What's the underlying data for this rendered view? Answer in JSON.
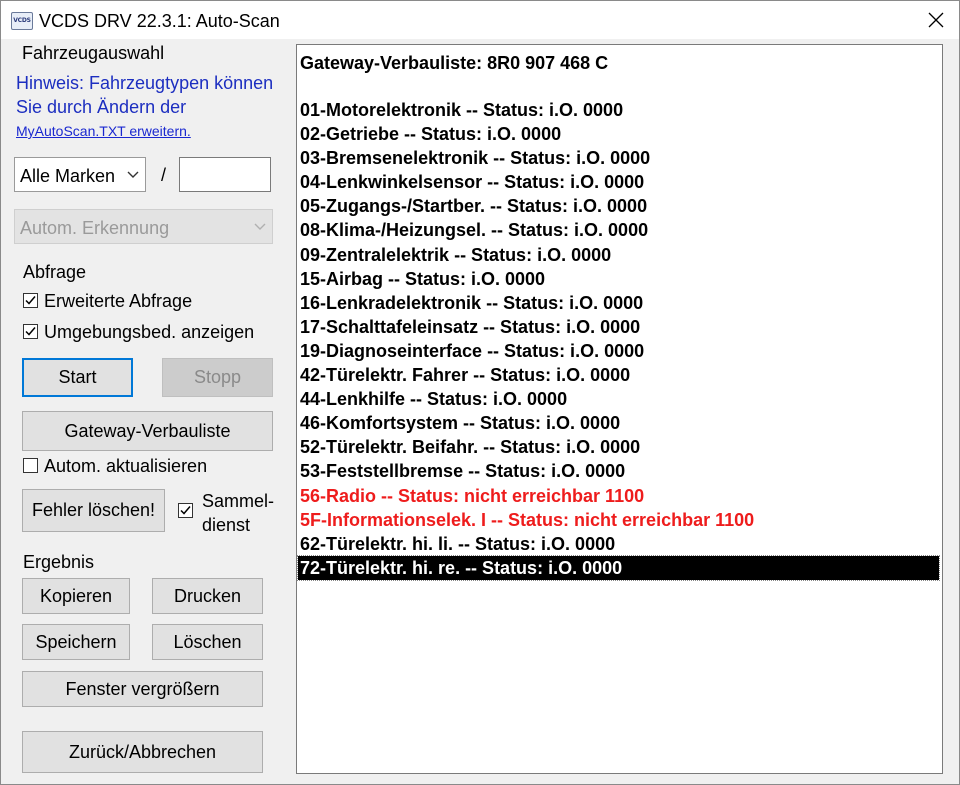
{
  "window": {
    "app_icon_text": "VCDS",
    "title": "VCDS DRV 22.3.1:  Auto-Scan"
  },
  "left_panel": {
    "vehicle_selection_label": "Fahrzeugauswahl",
    "hint_text": "Hinweis: Fahrzeugtypen können Sie durch Ändern der",
    "hint_link": "MyAutoScan.TXT erweitern.",
    "make_dropdown_value": "Alle Marken",
    "slash": "/",
    "model_input_value": "",
    "detection_dropdown_value": "Autom. Erkennung",
    "query_label": "Abfrage",
    "extended_query": {
      "label": "Erweiterte Abfrage",
      "checked": true
    },
    "show_environment": {
      "label": "Umgebungsbed. anzeigen",
      "checked": true
    },
    "start_button": "Start",
    "stop_button": "Stopp",
    "gateway_button": "Gateway-Verbauliste",
    "auto_update": {
      "label": "Autom. aktualisieren",
      "checked": false
    },
    "clear_faults_button": "Fehler löschen!",
    "collective_service": {
      "label_line1": "Sammel-",
      "label_line2": "dienst",
      "checked": true
    },
    "result_label": "Ergebnis",
    "copy_button": "Kopieren",
    "print_button": "Drucken",
    "save_button": "Speichern",
    "delete_button": "Löschen",
    "enlarge_button": "Fenster vergrößern",
    "back_button": "Zurück/Abbrechen"
  },
  "results": {
    "header": "Gateway-Verbauliste:  8R0 907 468 C",
    "items": [
      {
        "text": "01-Motorelektronik -- Status: i.O. 0000",
        "state": "ok"
      },
      {
        "text": "02-Getriebe -- Status: i.O. 0000",
        "state": "ok"
      },
      {
        "text": "03-Bremsenelektronik -- Status: i.O. 0000",
        "state": "ok"
      },
      {
        "text": "04-Lenkwinkelsensor -- Status: i.O. 0000",
        "state": "ok"
      },
      {
        "text": "05-Zugangs-/Startber. -- Status: i.O. 0000",
        "state": "ok"
      },
      {
        "text": "08-Klima-/Heizungsel. -- Status: i.O. 0000",
        "state": "ok"
      },
      {
        "text": "09-Zentralelektrik -- Status: i.O. 0000",
        "state": "ok"
      },
      {
        "text": "15-Airbag -- Status: i.O. 0000",
        "state": "ok"
      },
      {
        "text": "16-Lenkradelektronik -- Status: i.O. 0000",
        "state": "ok"
      },
      {
        "text": "17-Schalttafeleinsatz -- Status: i.O. 0000",
        "state": "ok"
      },
      {
        "text": "19-Diagnoseinterface -- Status: i.O. 0000",
        "state": "ok"
      },
      {
        "text": "42-Türelektr. Fahrer -- Status: i.O. 0000",
        "state": "ok"
      },
      {
        "text": "44-Lenkhilfe -- Status: i.O. 0000",
        "state": "ok"
      },
      {
        "text": "46-Komfortsystem -- Status: i.O. 0000",
        "state": "ok"
      },
      {
        "text": "52-Türelektr. Beifahr. -- Status: i.O. 0000",
        "state": "ok"
      },
      {
        "text": "53-Feststellbremse -- Status: i.O. 0000",
        "state": "ok"
      },
      {
        "text": "56-Radio -- Status: nicht erreichbar 1100",
        "state": "error"
      },
      {
        "text": "5F-Informationselek. I -- Status: nicht erreichbar 1100",
        "state": "error"
      },
      {
        "text": "62-Türelektr. hi. li. -- Status: i.O. 0000",
        "state": "ok"
      },
      {
        "text": "72-Türelektr. hi. re. -- Status: i.O. 0000",
        "state": "selected"
      }
    ]
  },
  "colors": {
    "error_text": "#ee1c1c",
    "hint_text": "#1c2ec0",
    "selection_bg": "#000000",
    "focus_border": "#0078d7"
  }
}
